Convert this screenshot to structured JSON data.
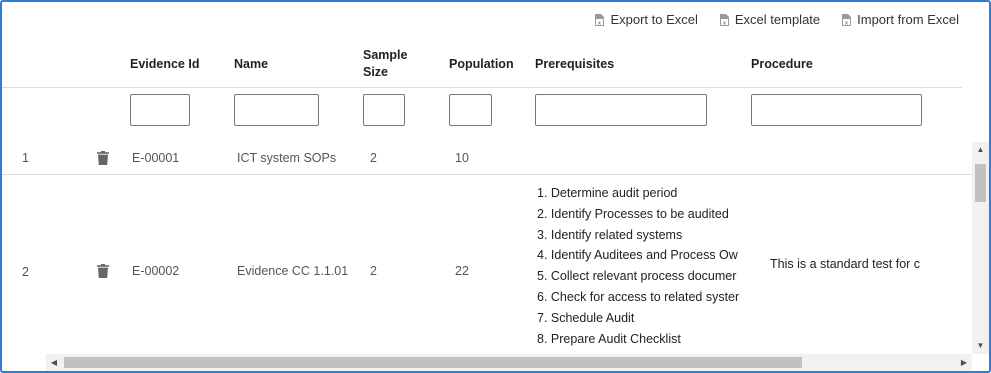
{
  "toolbar": {
    "export_label": "Export to Excel",
    "template_label": "Excel template",
    "import_label": "Import from Excel"
  },
  "columns": {
    "evidence_id": "Evidence Id",
    "name": "Name",
    "sample_size_line1": "Sample",
    "sample_size_line2": "Size",
    "population": "Population",
    "prerequisites": "Prerequisites",
    "procedure": "Procedure"
  },
  "filters": {
    "evidence_id": "",
    "name": "",
    "sample_size": "",
    "population": "",
    "prerequisites": "",
    "procedure": ""
  },
  "rows": [
    {
      "index": "1",
      "evidence_id": "E-00001",
      "name": "ICT system SOPs",
      "sample_size": "2",
      "population": "10",
      "prerequisites": [],
      "procedure": ""
    },
    {
      "index": "2",
      "evidence_id": "E-00002",
      "name": "Evidence CC 1.1.01",
      "sample_size": "2",
      "population": "22",
      "prerequisites": [
        "1. Determine audit period",
        "2. Identify Processes to be audited",
        "3. Identify related systems",
        "4. Identify Auditees and Process Ow",
        "5. Collect relevant process documer",
        "6. Check for access to related syster",
        "7. Schedule Audit",
        "8. Prepare Audit Checklist"
      ],
      "procedure": "This is a standard test for  c"
    }
  ],
  "colors": {
    "frame_border": "#2b7fd6",
    "scrollbar_track": "#f1f1f1",
    "scrollbar_thumb": "#c1c1c1",
    "trash_icon": "#666666"
  },
  "icons": {
    "export": "excel-file-icon",
    "template": "excel-file-icon",
    "import": "excel-file-icon",
    "delete": "trash-icon"
  }
}
